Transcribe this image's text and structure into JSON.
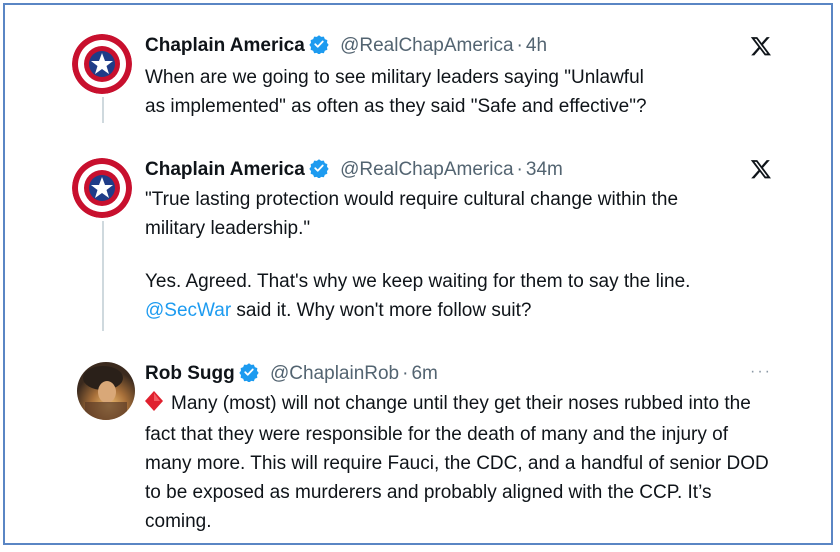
{
  "tweets": [
    {
      "name": "Chaplain America",
      "handle": "@RealChapAmerica",
      "dot": "·",
      "time": "4h",
      "text": "When are we going to see military leaders saying \"Unlawful as implemented\" as often as they said \"Safe and effective\"?"
    },
    {
      "name": "Chaplain America",
      "handle": "@RealChapAmerica",
      "dot": "·",
      "time": "34m",
      "quote": "\"True lasting protection would require cultural change within the military leadership.\"",
      "text_line": "Yes. Agreed. That's why we keep waiting for them to say the line.",
      "mention": "@SecWar",
      "text_after_mention": " said it. Why won't more follow suit?"
    },
    {
      "name": "Rob Sugg",
      "handle": "@ChaplainRob",
      "dot": "·",
      "time": "6m",
      "text": "Many (most) will not change until they get their noses rubbed into the fact that they were responsible for the death of many and the injury of many more. This will require Fauci, the CDC, and a handful of senior DOD to be exposed as murderers and probably aligned with the CCP. It’s coming.",
      "more": "···"
    }
  ],
  "icons": {
    "verified": "verified-badge-icon",
    "x_logo": "x-logo-icon",
    "diamond": "red-diamond-emoji-icon"
  },
  "colors": {
    "verified": "#1d9bf0",
    "mention": "#1d9bf0",
    "secondary_text": "#536471",
    "frame_border": "#5a86c4"
  }
}
